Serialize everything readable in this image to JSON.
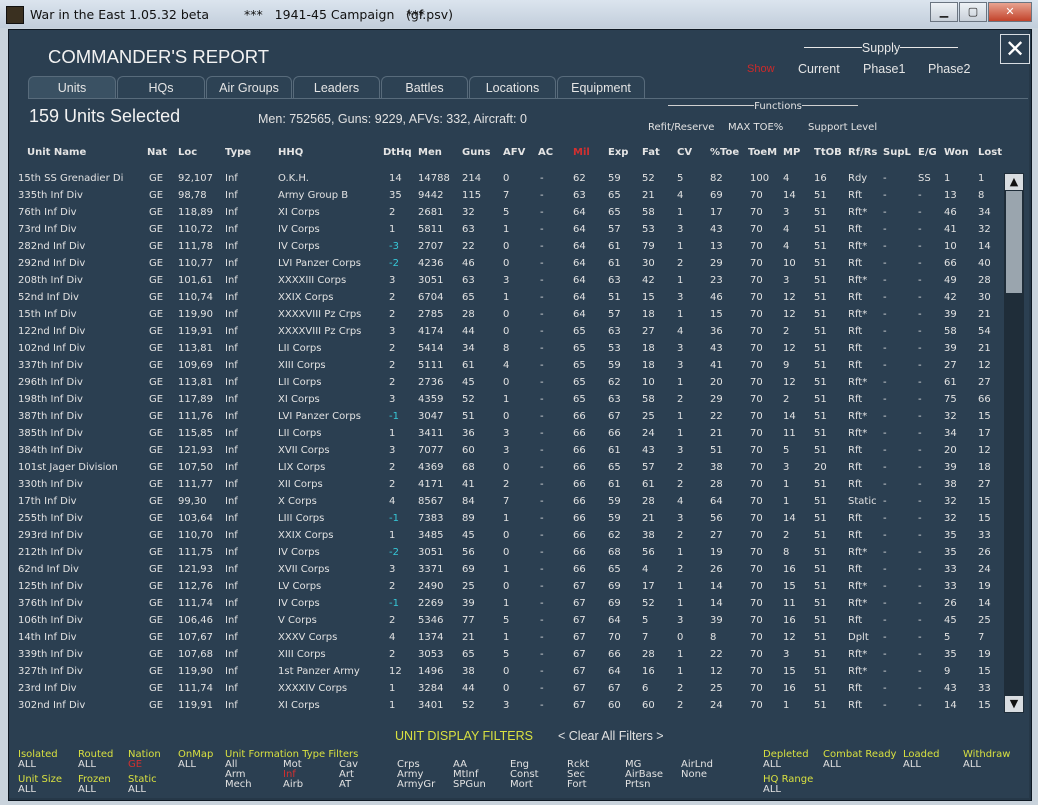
{
  "window": {
    "title": "War in the East 1.05.32 beta",
    "campaign": "***   1941-45 Campaign   ***",
    "file": "(gf.psv)"
  },
  "report": {
    "title": "COMMANDER'S REPORT"
  },
  "supply": {
    "label": "Supply",
    "modes": [
      "Current",
      "Phase1",
      "Phase2"
    ],
    "toggle": "Show"
  },
  "tabs": [
    "Units",
    "HQs",
    "Air Groups",
    "Leaders",
    "Battles",
    "Locations",
    "Equipment"
  ],
  "selection": {
    "label": "159 Units Selected",
    "summary": "Men: 752565, Guns: 9229, AFVs: 332, Aircraft: 0"
  },
  "functions": {
    "label": "Functions",
    "items": [
      "Refit/Reserve",
      "MAX TOE%",
      "Support Level"
    ]
  },
  "columns": [
    "Unit Name",
    "Nat",
    "Loc",
    "Type",
    "HHQ",
    "DtHq",
    "Men",
    "Guns",
    "AFV",
    "AC",
    "Mil",
    "Exp",
    "Fat",
    "CV",
    "%Toe",
    "ToeM",
    "MP",
    "TtOB",
    "Rf/Rs",
    "SupL",
    "E/G",
    "Won",
    "Lost"
  ],
  "rows": [
    [
      "15th SS Grenadier Di",
      "GE",
      "92,107",
      "Inf",
      "O.K.H.",
      "14",
      "14788",
      "214",
      "0",
      "-",
      "62",
      "59",
      "52",
      "5",
      "82",
      "100",
      "4",
      "16",
      "Rdy",
      "-",
      "SS",
      "1",
      "1"
    ],
    [
      "335th Inf Div",
      "GE",
      "98,78",
      "Inf",
      "Army Group B",
      "35",
      "9442",
      "115",
      "7",
      "-",
      "63",
      "65",
      "21",
      "4",
      "69",
      "70",
      "14",
      "51",
      "Rft",
      "-",
      "-",
      "13",
      "8"
    ],
    [
      "76th Inf Div",
      "GE",
      "118,89",
      "Inf",
      "XI Corps",
      "2",
      "2681",
      "32",
      "5",
      "-",
      "64",
      "65",
      "58",
      "1",
      "17",
      "70",
      "3",
      "51",
      "Rft*",
      "-",
      "-",
      "46",
      "34"
    ],
    [
      "73rd Inf Div",
      "GE",
      "110,72",
      "Inf",
      "IV Corps",
      "1",
      "5811",
      "63",
      "1",
      "-",
      "64",
      "57",
      "53",
      "3",
      "43",
      "70",
      "4",
      "51",
      "Rft",
      "-",
      "-",
      "41",
      "32"
    ],
    [
      "282nd Inf Div",
      "GE",
      "111,78",
      "Inf",
      "IV Corps",
      "-3",
      "2707",
      "22",
      "0",
      "-",
      "64",
      "61",
      "79",
      "1",
      "13",
      "70",
      "4",
      "51",
      "Rft*",
      "-",
      "-",
      "10",
      "14"
    ],
    [
      "292nd Inf Div",
      "GE",
      "110,77",
      "Inf",
      "LVI Panzer Corps",
      "-2",
      "4236",
      "46",
      "0",
      "-",
      "64",
      "61",
      "30",
      "2",
      "29",
      "70",
      "10",
      "51",
      "Rft",
      "-",
      "-",
      "66",
      "40"
    ],
    [
      "208th Inf Div",
      "GE",
      "101,61",
      "Inf",
      "XXXXIII Corps",
      "3",
      "3051",
      "63",
      "3",
      "-",
      "64",
      "63",
      "42",
      "1",
      "23",
      "70",
      "3",
      "51",
      "Rft*",
      "-",
      "-",
      "49",
      "28"
    ],
    [
      "52nd Inf Div",
      "GE",
      "110,74",
      "Inf",
      "XXIX Corps",
      "2",
      "6704",
      "65",
      "1",
      "-",
      "64",
      "51",
      "15",
      "3",
      "46",
      "70",
      "12",
      "51",
      "Rft",
      "-",
      "-",
      "42",
      "30"
    ],
    [
      "15th Inf Div",
      "GE",
      "119,90",
      "Inf",
      "XXXXVIII Pz Crps",
      "2",
      "2785",
      "28",
      "0",
      "-",
      "64",
      "57",
      "18",
      "1",
      "15",
      "70",
      "12",
      "51",
      "Rft*",
      "-",
      "-",
      "39",
      "21"
    ],
    [
      "122nd Inf Div",
      "GE",
      "119,91",
      "Inf",
      "XXXXVIII Pz Crps",
      "3",
      "4174",
      "44",
      "0",
      "-",
      "65",
      "63",
      "27",
      "4",
      "36",
      "70",
      "2",
      "51",
      "Rft",
      "-",
      "-",
      "58",
      "54"
    ],
    [
      "102nd Inf Div",
      "GE",
      "113,81",
      "Inf",
      "LII Corps",
      "2",
      "5414",
      "34",
      "8",
      "-",
      "65",
      "53",
      "18",
      "3",
      "43",
      "70",
      "12",
      "51",
      "Rft",
      "-",
      "-",
      "39",
      "21"
    ],
    [
      "337th Inf Div",
      "GE",
      "109,69",
      "Inf",
      "XIII Corps",
      "2",
      "5111",
      "61",
      "4",
      "-",
      "65",
      "59",
      "18",
      "3",
      "41",
      "70",
      "9",
      "51",
      "Rft",
      "-",
      "-",
      "27",
      "12"
    ],
    [
      "296th Inf Div",
      "GE",
      "113,81",
      "Inf",
      "LII Corps",
      "2",
      "2736",
      "45",
      "0",
      "-",
      "65",
      "62",
      "10",
      "1",
      "20",
      "70",
      "12",
      "51",
      "Rft*",
      "-",
      "-",
      "61",
      "27"
    ],
    [
      "198th Inf Div",
      "GE",
      "117,89",
      "Inf",
      "XI Corps",
      "3",
      "4359",
      "52",
      "1",
      "-",
      "65",
      "63",
      "58",
      "2",
      "29",
      "70",
      "2",
      "51",
      "Rft",
      "-",
      "-",
      "75",
      "66"
    ],
    [
      "387th Inf Div",
      "GE",
      "111,76",
      "Inf",
      "LVI Panzer Corps",
      "-1",
      "3047",
      "51",
      "0",
      "-",
      "66",
      "67",
      "25",
      "1",
      "22",
      "70",
      "14",
      "51",
      "Rft*",
      "-",
      "-",
      "32",
      "15"
    ],
    [
      "385th Inf Div",
      "GE",
      "115,85",
      "Inf",
      "LII Corps",
      "1",
      "3411",
      "36",
      "3",
      "-",
      "66",
      "66",
      "24",
      "1",
      "21",
      "70",
      "11",
      "51",
      "Rft*",
      "-",
      "-",
      "34",
      "17"
    ],
    [
      "384th Inf Div",
      "GE",
      "121,93",
      "Inf",
      "XVII Corps",
      "3",
      "7077",
      "60",
      "3",
      "-",
      "66",
      "61",
      "43",
      "3",
      "51",
      "70",
      "5",
      "51",
      "Rft",
      "-",
      "-",
      "20",
      "12"
    ],
    [
      "101st Jager Division",
      "GE",
      "107,50",
      "Inf",
      "LIX Corps",
      "2",
      "4369",
      "68",
      "0",
      "-",
      "66",
      "65",
      "57",
      "2",
      "38",
      "70",
      "3",
      "20",
      "Rft",
      "-",
      "-",
      "39",
      "18"
    ],
    [
      "330th Inf Div",
      "GE",
      "111,77",
      "Inf",
      "XII Corps",
      "2",
      "4171",
      "41",
      "2",
      "-",
      "66",
      "61",
      "61",
      "2",
      "28",
      "70",
      "1",
      "51",
      "Rft",
      "-",
      "-",
      "38",
      "27"
    ],
    [
      "17th Inf Div",
      "GE",
      "99,30",
      "Inf",
      "X Corps",
      "4",
      "8567",
      "84",
      "7",
      "-",
      "66",
      "59",
      "28",
      "4",
      "64",
      "70",
      "1",
      "51",
      "Static",
      "-",
      "-",
      "32",
      "15"
    ],
    [
      "255th Inf Div",
      "GE",
      "103,64",
      "Inf",
      "LIII Corps",
      "-1",
      "7383",
      "89",
      "1",
      "-",
      "66",
      "59",
      "21",
      "3",
      "56",
      "70",
      "14",
      "51",
      "Rft",
      "-",
      "-",
      "32",
      "15"
    ],
    [
      "293rd Inf Div",
      "GE",
      "110,70",
      "Inf",
      "XXIX Corps",
      "1",
      "3485",
      "45",
      "0",
      "-",
      "66",
      "62",
      "38",
      "2",
      "27",
      "70",
      "2",
      "51",
      "Rft",
      "-",
      "-",
      "35",
      "33"
    ],
    [
      "212th Inf Div",
      "GE",
      "111,75",
      "Inf",
      "IV Corps",
      "-2",
      "3051",
      "56",
      "0",
      "-",
      "66",
      "68",
      "56",
      "1",
      "19",
      "70",
      "8",
      "51",
      "Rft*",
      "-",
      "-",
      "35",
      "26"
    ],
    [
      "62nd Inf Div",
      "GE",
      "121,93",
      "Inf",
      "XVII Corps",
      "3",
      "3371",
      "69",
      "1",
      "-",
      "66",
      "65",
      "4",
      "2",
      "26",
      "70",
      "16",
      "51",
      "Rft",
      "-",
      "-",
      "33",
      "24"
    ],
    [
      "125th Inf Div",
      "GE",
      "112,76",
      "Inf",
      "LV Corps",
      "2",
      "2490",
      "25",
      "0",
      "-",
      "67",
      "69",
      "17",
      "1",
      "14",
      "70",
      "15",
      "51",
      "Rft*",
      "-",
      "-",
      "33",
      "19"
    ],
    [
      "376th Inf Div",
      "GE",
      "111,74",
      "Inf",
      "IV Corps",
      "-1",
      "2269",
      "39",
      "1",
      "-",
      "67",
      "69",
      "52",
      "1",
      "14",
      "70",
      "11",
      "51",
      "Rft*",
      "-",
      "-",
      "26",
      "14"
    ],
    [
      "106th Inf Div",
      "GE",
      "106,46",
      "Inf",
      "V Corps",
      "2",
      "5346",
      "77",
      "5",
      "-",
      "67",
      "64",
      "5",
      "3",
      "39",
      "70",
      "16",
      "51",
      "Rft",
      "-",
      "-",
      "45",
      "25"
    ],
    [
      "14th Inf Div",
      "GE",
      "107,67",
      "Inf",
      "XXXV Corps",
      "4",
      "1374",
      "21",
      "1",
      "-",
      "67",
      "70",
      "7",
      "0",
      "8",
      "70",
      "12",
      "51",
      "Dplt",
      "-",
      "-",
      "5",
      "7"
    ],
    [
      "339th Inf Div",
      "GE",
      "107,68",
      "Inf",
      "XIII Corps",
      "2",
      "3053",
      "65",
      "5",
      "-",
      "67",
      "66",
      "28",
      "1",
      "22",
      "70",
      "3",
      "51",
      "Rft*",
      "-",
      "-",
      "35",
      "19"
    ],
    [
      "327th Inf Div",
      "GE",
      "119,90",
      "Inf",
      "1st Panzer Army",
      "12",
      "1496",
      "38",
      "0",
      "-",
      "67",
      "64",
      "16",
      "1",
      "12",
      "70",
      "15",
      "51",
      "Rft*",
      "-",
      "-",
      "9",
      "15"
    ],
    [
      "23rd Inf Div",
      "GE",
      "111,74",
      "Inf",
      "XXXXIV Corps",
      "1",
      "3284",
      "44",
      "0",
      "-",
      "67",
      "67",
      "6",
      "2",
      "25",
      "70",
      "16",
      "51",
      "Rft",
      "-",
      "-",
      "43",
      "33"
    ],
    [
      "302nd Inf Div",
      "GE",
      "119,91",
      "Inf",
      "XI Corps",
      "1",
      "3401",
      "52",
      "3",
      "-",
      "67",
      "60",
      "60",
      "2",
      "24",
      "70",
      "1",
      "51",
      "Rft",
      "-",
      "-",
      "14",
      "15"
    ]
  ],
  "filters": {
    "title": "UNIT DISPLAY FILTERS",
    "clear": "< Clear All Filters >",
    "isolated": {
      "label": "Isolated",
      "value": "ALL"
    },
    "routed": {
      "label": "Routed",
      "value": "ALL"
    },
    "nation": {
      "label": "Nation",
      "value": "GE"
    },
    "onmap": {
      "label": "OnMap",
      "value": "ALL"
    },
    "unit_formation_type_filters": "Unit  Formation  Type  Filters",
    "unit_size": {
      "label": "Unit Size",
      "value": "ALL"
    },
    "frozen": {
      "label": "Frozen",
      "value": "ALL"
    },
    "static": {
      "label": "Static",
      "value": "ALL"
    },
    "types": {
      "c1": [
        "All",
        "Arm",
        "Mech"
      ],
      "c2": [
        "Mot",
        "Inf",
        "Airb"
      ],
      "c3": [
        "Cav",
        "Art",
        "AT"
      ],
      "c4": [
        "Crps",
        "Army",
        "ArmyGr"
      ],
      "c5": [
        "AA",
        "MtInf",
        "SPGun"
      ],
      "c6": [
        "Eng",
        "Const",
        "Mort"
      ],
      "c7": [
        "Rckt",
        "Sec",
        "Fort"
      ],
      "c8": [
        "MG",
        "AirBase",
        "Prtsn"
      ],
      "c9": [
        "AirLnd",
        "None"
      ]
    },
    "depleted": {
      "label": "Depleted",
      "value": "ALL"
    },
    "combat_ready": {
      "label": "Combat Ready",
      "value": "ALL"
    },
    "loaded": {
      "label": "Loaded",
      "value": "ALL"
    },
    "withdraw": {
      "label": "Withdraw",
      "value": "ALL"
    },
    "hq_range": {
      "label": "HQ Range",
      "value": "ALL"
    }
  },
  "scrollbar": {
    "up": "▲",
    "down": "▼"
  }
}
